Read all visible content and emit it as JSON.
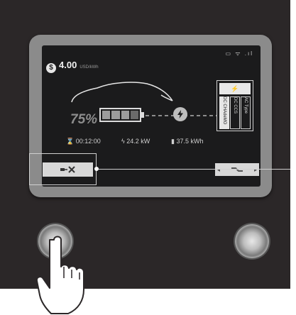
{
  "status_icons": "▭ ᯤ .ıl",
  "price": {
    "value": "4.00",
    "unit": "USD/kWh",
    "icon": "dollar-charge-icon"
  },
  "soc": {
    "percent_label": "75%",
    "battery_fraction": 0.75
  },
  "connectors": {
    "top_icon_label": "⚡",
    "options": [
      "DC CHAdeMO",
      "DC CCS",
      "AC Type"
    ]
  },
  "stats": {
    "time": "00:12:00",
    "power": "24.2 kW",
    "energy": "37.5 kWh"
  },
  "icons": {
    "hourglass": "⌛",
    "bolt": "ϟ",
    "battery": "▮"
  }
}
